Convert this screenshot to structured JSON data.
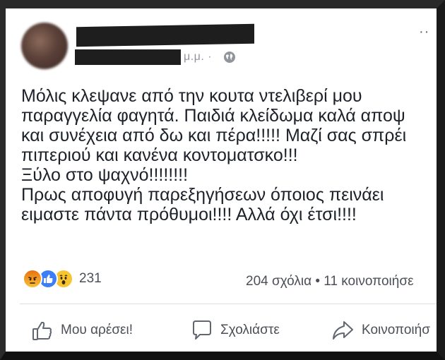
{
  "post": {
    "time_suffix": "μ.μ. ·",
    "more_label": "··",
    "lines": [
      "Μόλις κλεψανε από την κουτα ντελιβερί μου",
      "παραγγελία φαγητά. Παιδιά κλείδωμα καλά αποψ",
      "και συνέχεια από δω και πέρα!!!!! Μαζί σας σπρέι",
      "πιπεριού και κανένα κοντοματσκο!!!",
      "Ξύλο στο ψαχνό!!!!!!!!",
      "Πρως αποφυγή παρεξηγήσεων όποιος πεινάει",
      "ειμαστε πάντα πρόθυμοι!!!! Αλλά όχι έτσι!!!!"
    ]
  },
  "reactions": {
    "icons": [
      "angry-icon",
      "like-icon",
      "wow-icon"
    ],
    "count": "231"
  },
  "stats": {
    "summary": "204 σχόλια • 11 κοινοποιήσε"
  },
  "actions": {
    "like_label": "Μου αρέσει!",
    "comment_label": "Σχολιάστε",
    "share_label": "Κοινοποιήσ"
  },
  "colors": {
    "text": "#1d2129",
    "muted": "#4b4f56",
    "like_blue": "#3b7ef7",
    "frame": "#2a2a2a"
  }
}
